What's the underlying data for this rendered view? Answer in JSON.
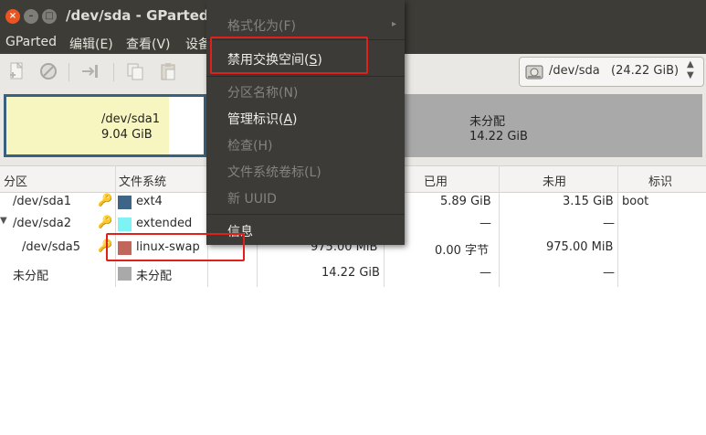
{
  "window": {
    "title": "/dev/sda - GParted",
    "close_glyph": "×",
    "min_glyph": "–",
    "max_glyph": "□"
  },
  "menubar": {
    "items": [
      "GParted",
      "编辑(E)",
      "查看(V)",
      "设备"
    ]
  },
  "device_selector": {
    "device": "/dev/sda",
    "size": "(24.22 GiB)"
  },
  "visual": {
    "sda1": {
      "name": "/dev/sda1",
      "size": "9.04 GiB"
    },
    "unallocated": {
      "name": "未分配",
      "size": "14.22 GiB"
    }
  },
  "table": {
    "headers": {
      "partition": "分区",
      "filesystem": "文件系统",
      "used": "已用",
      "unused": "未用",
      "flags": "标识"
    },
    "rows": [
      {
        "partition": "/dev/sda1",
        "filesystem": "ext4",
        "fs_color": "#3e6487",
        "size": "",
        "used": "5.89 GiB",
        "unused": "3.15 GiB",
        "flags": "boot"
      },
      {
        "partition": "/dev/sda2",
        "filesystem": "extended",
        "fs_color": "#7ef3f3",
        "size": "",
        "used": "—",
        "unused": "—",
        "flags": ""
      },
      {
        "partition": "/dev/sda5",
        "filesystem": "linux-swap",
        "fs_color": "#c1665a",
        "size": "975.00 MiB",
        "used": "0.00 字节",
        "unused": "975.00 MiB",
        "flags": ""
      },
      {
        "partition": "未分配",
        "filesystem": "未分配",
        "fs_color": "#a9a9a9",
        "size": "14.22 GiB",
        "used": "—",
        "unused": "—",
        "flags": ""
      }
    ]
  },
  "context_menu": {
    "format_as": "格式化为(F)",
    "swapoff": {
      "text": "禁用交换空间(",
      "key": "S",
      "tail": ")"
    },
    "name_partition": "分区名称(N)",
    "manage_flags": {
      "text": "管理标识(",
      "key": "A",
      "tail": ")"
    },
    "check": "检查(H)",
    "label_fs": "文件系统卷标(L)",
    "new_uuid": "新 UUID",
    "info": "信息"
  },
  "colors": {
    "accent_close": "#e95420",
    "annotation": "#e0201b",
    "unallocated": "#a9a9a9"
  }
}
